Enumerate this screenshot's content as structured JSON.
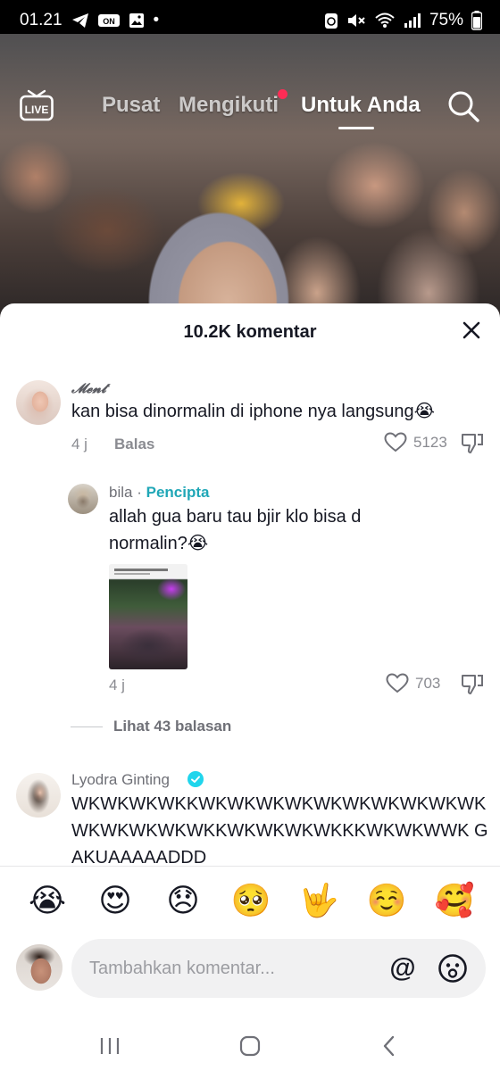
{
  "status_bar": {
    "time": "01.21",
    "battery": "75%",
    "dot": "•"
  },
  "top_nav": {
    "live_label": "LIVE",
    "tabs": [
      {
        "label": "Pusat"
      },
      {
        "label": "Mengikuti"
      },
      {
        "label": "Untuk Anda"
      }
    ],
    "active_tab": "Untuk Anda"
  },
  "comments_panel": {
    "title": "10.2K komentar",
    "comments": [
      {
        "username": "𝓜𝓮𝓷𝓽",
        "text": "kan bisa dinormalin di iphone nya langsung😭",
        "age": "4 j",
        "reply_label": "Balas",
        "likes": "5123"
      },
      {
        "username": "bila",
        "separator": "·",
        "creator_label": "Pencipta",
        "text": "allah gua baru tau bjir klo bisa d normalin?😭",
        "age": "4 j",
        "likes": "703"
      },
      {
        "username": "Lyodra Ginting",
        "verified": true,
        "text": "WKWKWKWKKWKWKWKWKWKWKWKWKWKWKWKWKWKWKWKKWKWKWKWKKKWKWKWWK GAKUAAAAADDD"
      }
    ],
    "view_replies": "Lihat 43 balasan"
  },
  "emoji_bar": [
    "😭",
    "😍",
    "😞",
    "🥺",
    "🤟",
    "☺️",
    "🥰"
  ],
  "input": {
    "placeholder": "Tambahkan komentar...",
    "mention_symbol": "@"
  },
  "colors": {
    "accent_red": "#fe2c55",
    "creator_teal": "#20a7b7",
    "verified_blue": "#20d5ec"
  }
}
